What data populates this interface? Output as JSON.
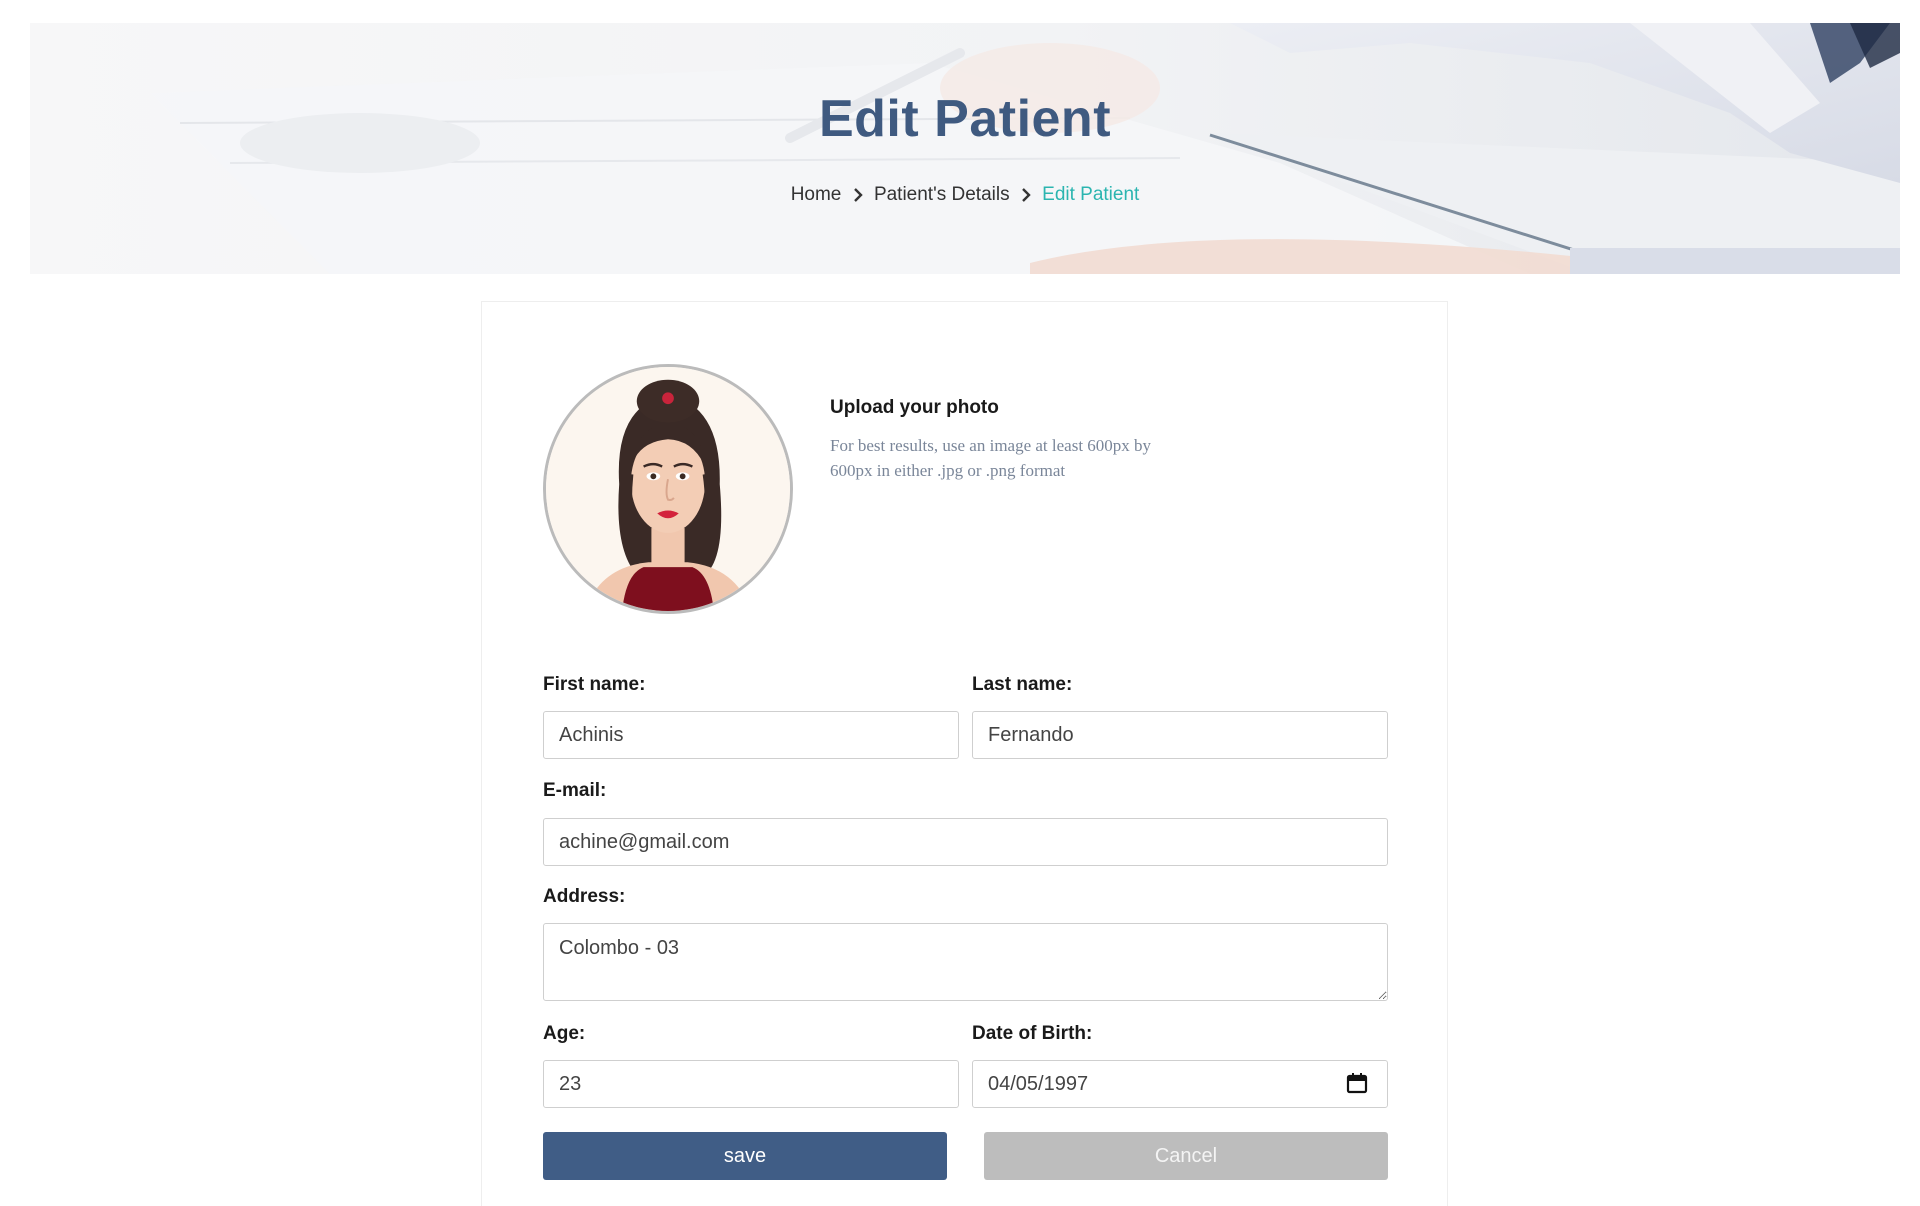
{
  "banner": {
    "title": "Edit Patient",
    "breadcrumb": [
      {
        "label": "Home"
      },
      {
        "label": "Patient's Details"
      },
      {
        "label": "Edit Patient"
      }
    ]
  },
  "upload": {
    "title": "Upload your photo",
    "hint": "For best results, use an image at least 600px by 600px in either .jpg or .png format"
  },
  "form": {
    "first_name": {
      "label": "First name:",
      "value": "Achinis"
    },
    "last_name": {
      "label": "Last name:",
      "value": "Fernando"
    },
    "email": {
      "label": "E-mail:",
      "value": "achine@gmail.com"
    },
    "address": {
      "label": "Address:",
      "value": "Colombo - 03"
    },
    "age": {
      "label": "Age:",
      "value": "23"
    },
    "dob": {
      "label": "Date of Birth:",
      "value": "04/05/1997"
    }
  },
  "buttons": {
    "save": "save",
    "cancel": "Cancel"
  },
  "colors": {
    "accent": "#405d86",
    "title": "#3f5a80",
    "breadcrumb_active": "#2bb5b0",
    "cancel": "#bdbdbd"
  },
  "icons": {
    "breadcrumb_separator": "chevron-right-icon",
    "date_picker": "calendar-icon"
  }
}
